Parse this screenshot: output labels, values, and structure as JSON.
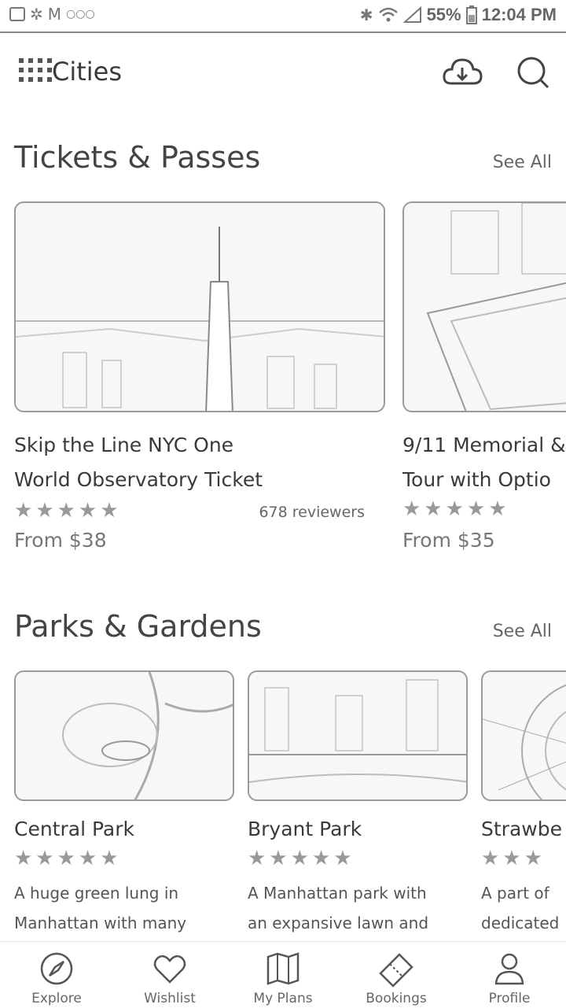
{
  "statusbar": {
    "battery": "55%",
    "time": "12:04 PM"
  },
  "header": {
    "title": "Cities",
    "icons": [
      "grid-icon",
      "cloud-download-icon",
      "search-icon"
    ]
  },
  "tickets": {
    "title": "Tickets & Passes",
    "see_all": "See All",
    "cards": [
      {
        "title_line1": "Skip the Line NYC One",
        "title_line2": "World Observatory Ticket",
        "stars": "★★★★★",
        "rating": 0,
        "reviews": "678 reviewers",
        "price": "From $38"
      },
      {
        "title_line1": "9/11 Memorial &",
        "title_line2": "Tour with Optio",
        "stars": "★★★★★",
        "rating": 0,
        "price": "From $35"
      }
    ]
  },
  "parks": {
    "title": "Parks & Gardens",
    "see_all": "See All",
    "cards": [
      {
        "title": "Central Park",
        "stars": "★★★★★",
        "rating": 0,
        "desc_line1": "A huge green lung in",
        "desc_line2": "Manhattan with many"
      },
      {
        "title": "Bryant Park",
        "stars": "★★★★★",
        "rating": 0,
        "desc_line1": "A Manhattan park with",
        "desc_line2": "an expansive lawn and"
      },
      {
        "title": "Strawbe",
        "stars": "★★★",
        "rating": 0,
        "desc_line1": "A part of",
        "desc_line2": "dedicated"
      }
    ]
  },
  "tabs": [
    {
      "label": "Explore",
      "icon": "compass-icon"
    },
    {
      "label": "Wishlist",
      "icon": "heart-icon"
    },
    {
      "label": "My Plans",
      "icon": "map-icon"
    },
    {
      "label": "Bookings",
      "icon": "ticket-icon"
    },
    {
      "label": "Profile",
      "icon": "person-icon"
    }
  ],
  "colors": {
    "background": "#ffffff",
    "text": "#3a3a3a",
    "muted": "#666666",
    "border": "#9a9a9a"
  }
}
